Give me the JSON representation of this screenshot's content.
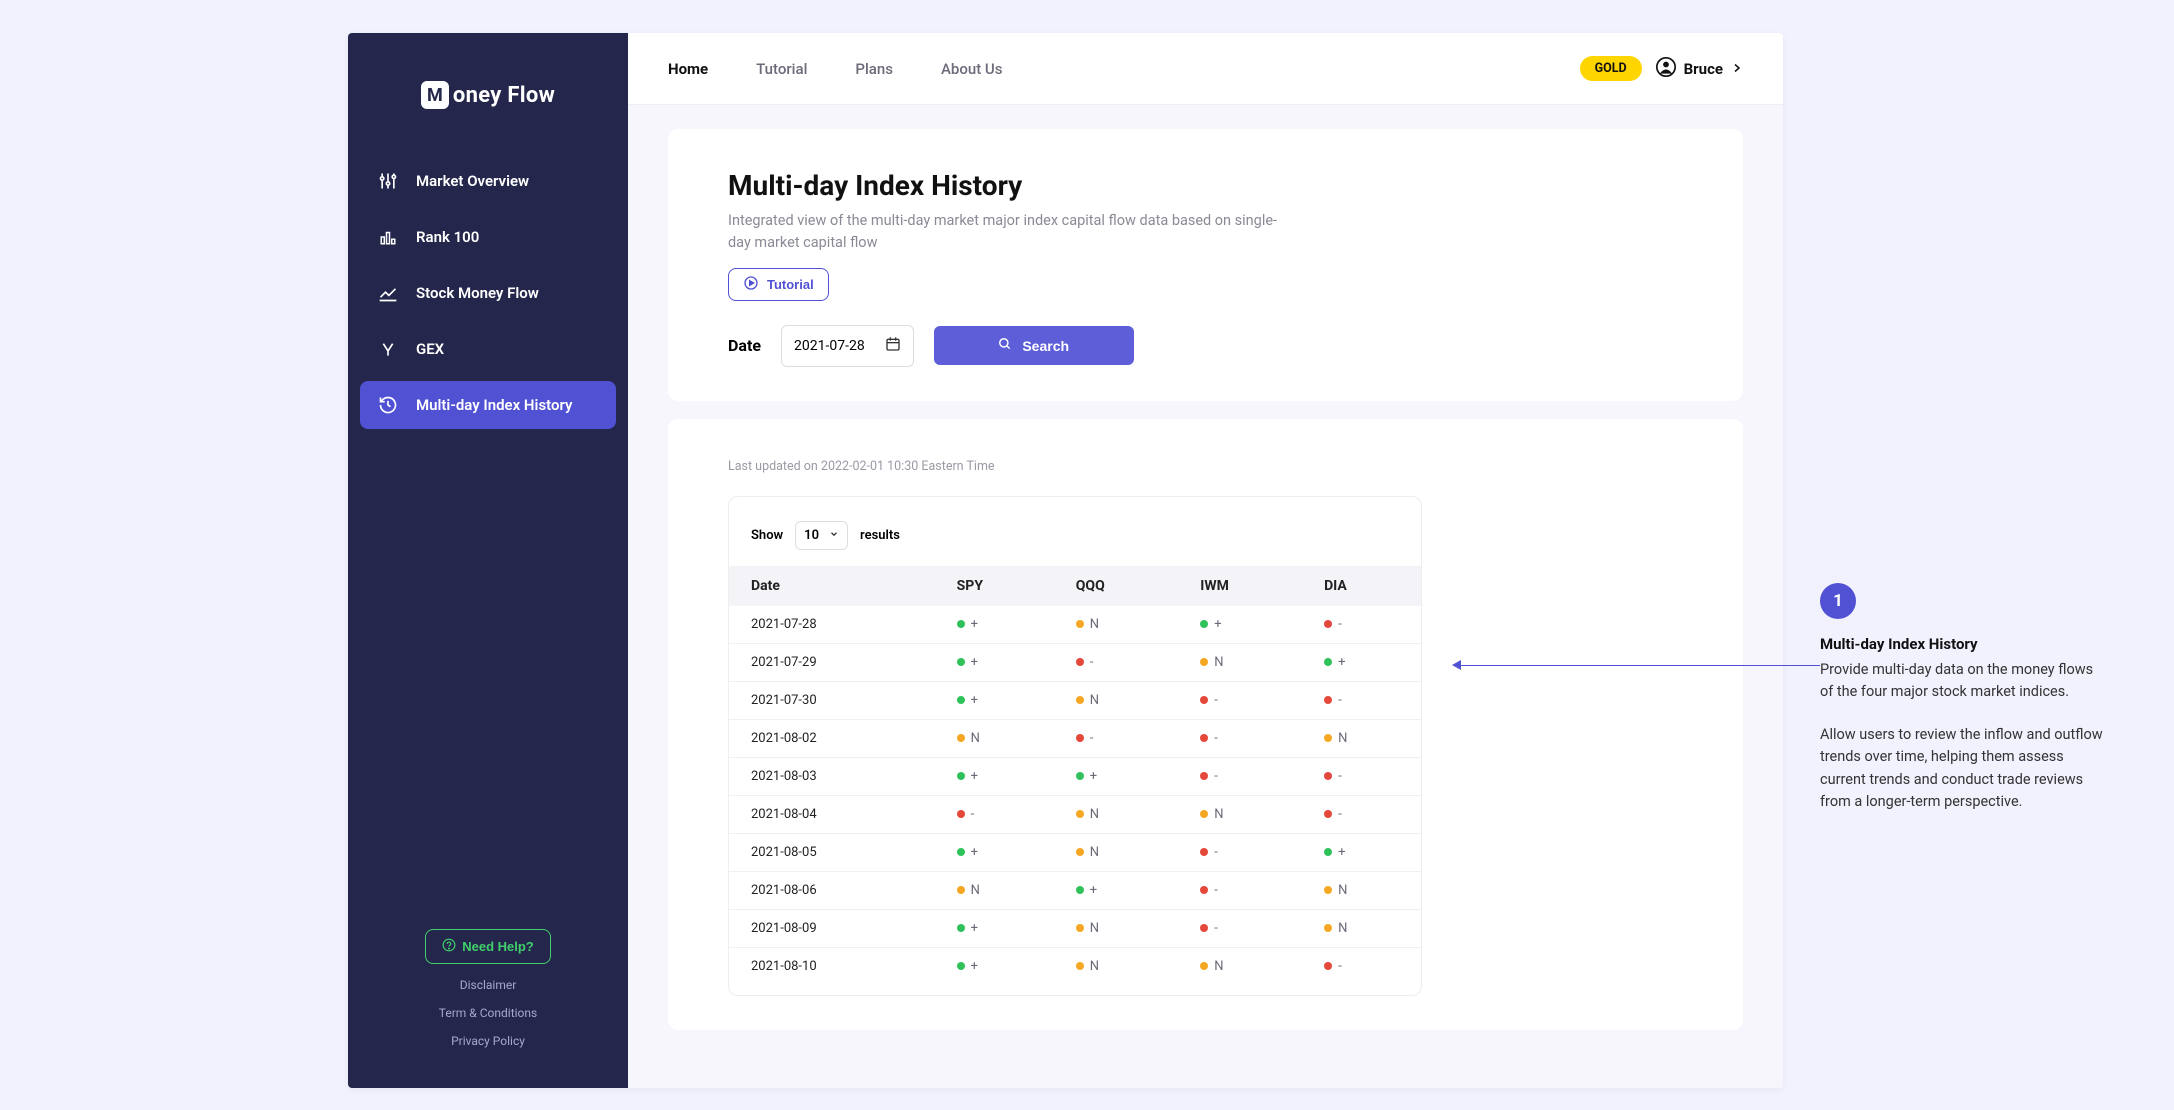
{
  "brand": {
    "badge": "M",
    "name": "oney Flow"
  },
  "sidebar": {
    "items": [
      {
        "label": "Market Overview"
      },
      {
        "label": "Rank 100"
      },
      {
        "label": "Stock Money Flow"
      },
      {
        "label": "GEX"
      },
      {
        "label": "Multi-day Index History"
      }
    ],
    "help": "Need Help?",
    "footer": [
      "Disclaimer",
      "Term & Conditions",
      "Privacy Policy"
    ]
  },
  "topnav": {
    "items": [
      "Home",
      "Tutorial",
      "Plans",
      "About Us"
    ],
    "badge": "GOLD",
    "user": "Bruce"
  },
  "page": {
    "title": "Multi-day Index History",
    "subtitle": "Integrated view of the multi-day market major index capital flow data based on single-day market capital flow",
    "tutorial": "Tutorial",
    "dateLabel": "Date",
    "dateValue": "2021-07-28",
    "searchLabel": "Search"
  },
  "table": {
    "lastUpdated": "Last updated on 2022-02-01 10:30 Eastern Time",
    "showLabel": "Show",
    "showValue": "10",
    "resultsLabel": "results",
    "headers": [
      "Date",
      "SPY",
      "QQQ",
      "IWM",
      "DIA"
    ],
    "rows": [
      {
        "date": "2021-07-28",
        "cells": [
          {
            "c": "green",
            "v": "+"
          },
          {
            "c": "orange",
            "v": "N"
          },
          {
            "c": "green",
            "v": "+"
          },
          {
            "c": "red",
            "v": "-"
          }
        ]
      },
      {
        "date": "2021-07-29",
        "cells": [
          {
            "c": "green",
            "v": "+"
          },
          {
            "c": "red",
            "v": "-"
          },
          {
            "c": "orange",
            "v": "N"
          },
          {
            "c": "green",
            "v": "+"
          }
        ]
      },
      {
        "date": "2021-07-30",
        "cells": [
          {
            "c": "green",
            "v": "+"
          },
          {
            "c": "orange",
            "v": "N"
          },
          {
            "c": "red",
            "v": "-"
          },
          {
            "c": "red",
            "v": "-"
          }
        ]
      },
      {
        "date": "2021-08-02",
        "cells": [
          {
            "c": "orange",
            "v": "N"
          },
          {
            "c": "red",
            "v": "-"
          },
          {
            "c": "red",
            "v": "-"
          },
          {
            "c": "orange",
            "v": "N"
          }
        ]
      },
      {
        "date": "2021-08-03",
        "cells": [
          {
            "c": "green",
            "v": "+"
          },
          {
            "c": "green",
            "v": "+"
          },
          {
            "c": "red",
            "v": "-"
          },
          {
            "c": "red",
            "v": "-"
          }
        ]
      },
      {
        "date": "2021-08-04",
        "cells": [
          {
            "c": "red",
            "v": "-"
          },
          {
            "c": "orange",
            "v": "N"
          },
          {
            "c": "orange",
            "v": "N"
          },
          {
            "c": "red",
            "v": "-"
          }
        ]
      },
      {
        "date": "2021-08-05",
        "cells": [
          {
            "c": "green",
            "v": "+"
          },
          {
            "c": "orange",
            "v": "N"
          },
          {
            "c": "red",
            "v": "-"
          },
          {
            "c": "green",
            "v": "+"
          }
        ]
      },
      {
        "date": "2021-08-06",
        "cells": [
          {
            "c": "orange",
            "v": "N"
          },
          {
            "c": "green",
            "v": "+"
          },
          {
            "c": "red",
            "v": "-"
          },
          {
            "c": "orange",
            "v": "N"
          }
        ]
      },
      {
        "date": "2021-08-09",
        "cells": [
          {
            "c": "green",
            "v": "+"
          },
          {
            "c": "orange",
            "v": "N"
          },
          {
            "c": "red",
            "v": "-"
          },
          {
            "c": "orange",
            "v": "N"
          }
        ]
      },
      {
        "date": "2021-08-10",
        "cells": [
          {
            "c": "green",
            "v": "+"
          },
          {
            "c": "orange",
            "v": "N"
          },
          {
            "c": "orange",
            "v": "N"
          },
          {
            "c": "red",
            "v": "-"
          }
        ]
      }
    ]
  },
  "annotation": {
    "num": "1",
    "title": "Multi-day Index History",
    "para1": "Provide multi-day data on the money flows of the four major stock market indices.",
    "para2": "Allow users to review the inflow and outflow trends over time, helping them assess current trends and conduct trade reviews from a longer-term perspective."
  }
}
